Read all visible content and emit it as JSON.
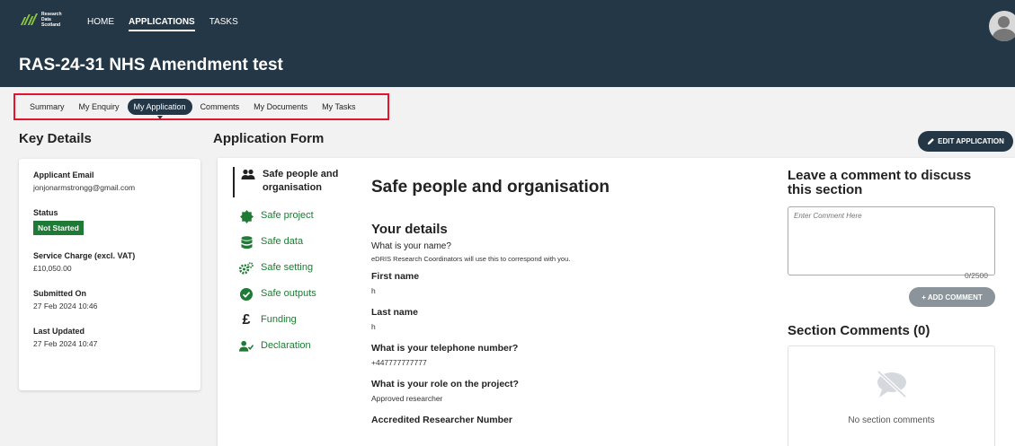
{
  "brand": {
    "line1": "Research",
    "line2": "Data",
    "line3": "Scotland"
  },
  "nav": [
    {
      "label": "HOME",
      "active": false
    },
    {
      "label": "APPLICATIONS",
      "active": true
    },
    {
      "label": "TASKS",
      "active": false
    }
  ],
  "page": {
    "title": "RAS-24-31 NHS Amendment test"
  },
  "tabs": [
    {
      "label": "Summary"
    },
    {
      "label": "My Enquiry"
    },
    {
      "label": "My Application"
    },
    {
      "label": "Comments"
    },
    {
      "label": "My Documents"
    },
    {
      "label": "My Tasks"
    }
  ],
  "key_details": {
    "heading": "Key Details",
    "email_label": "Applicant Email",
    "email_value": "jonjonarmstrongg@gmail.com",
    "status_label": "Status",
    "status_value": "Not Started",
    "charge_label": "Service Charge (excl. VAT)",
    "charge_value": "£10,050.00",
    "submitted_label": "Submitted On",
    "submitted_value": "27 Feb 2024 10:46",
    "updated_label": "Last Updated",
    "updated_value": "27 Feb 2024 10:47"
  },
  "application_form": {
    "heading": "Application Form",
    "edit_label": "EDIT APPLICATION",
    "sections": [
      {
        "label": "Safe people and organisation",
        "icon": "people-icon"
      },
      {
        "label": "Safe project",
        "icon": "badge-icon"
      },
      {
        "label": "Safe data",
        "icon": "database-icon"
      },
      {
        "label": "Safe setting",
        "icon": "cogs-icon"
      },
      {
        "label": "Safe outputs",
        "icon": "check-circle-icon"
      },
      {
        "label": "Funding",
        "icon": "pound-icon"
      },
      {
        "label": "Declaration",
        "icon": "user-check-icon"
      }
    ],
    "main": {
      "title": "Safe people and organisation",
      "subtitle": "Your details",
      "name_question": "What is your name?",
      "name_hint": "eDRIS Research Coordinators will use this to correspond with you.",
      "first_name_label": "First name",
      "first_name_value": "h",
      "last_name_label": "Last name",
      "last_name_value": "h",
      "phone_label": "What is your telephone number?",
      "phone_value": "+447777777777",
      "role_label": "What is your role on the project?",
      "role_value": "Approved researcher",
      "accredited_label": "Accredited Researcher Number"
    }
  },
  "comments": {
    "title": "Leave a comment to discuss this section",
    "placeholder": "Enter Comment Here",
    "counter": "0/2500",
    "add_label": "+ ADD COMMENT",
    "section_title": "Section Comments (0)",
    "empty_text": "No section comments"
  },
  "colors": {
    "header": "#243746",
    "accent_green": "#1e7a34",
    "highlight_red": "#e3142b"
  }
}
